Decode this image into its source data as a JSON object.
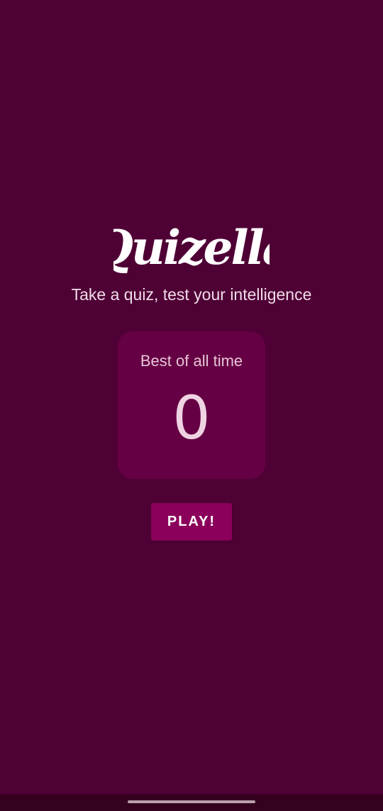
{
  "app": {
    "name": "Quizella",
    "tagline": "Take a quiz, test your intelligence"
  },
  "best_score": {
    "label": "Best of all time",
    "value": "0"
  },
  "play_button": {
    "label": "PLAY!"
  },
  "colors": {
    "background": "#4f0035",
    "card": "#660044",
    "button": "#8a005b",
    "text": "#f1dce8"
  }
}
